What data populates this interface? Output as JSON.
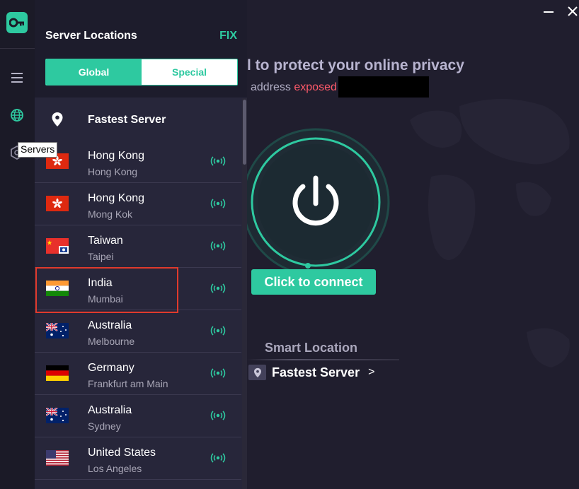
{
  "window": {
    "minimize_icon": "minimize-icon",
    "close_icon": "close-icon"
  },
  "rail": {
    "logo_icon": "key-icon",
    "items": [
      {
        "name": "menu",
        "icon": "hamburger-icon"
      },
      {
        "name": "servers",
        "icon": "globe-icon"
      },
      {
        "name": "settings",
        "icon": "hexagon-icon"
      }
    ],
    "tooltip": "Servers"
  },
  "panel": {
    "title": "Server Locations",
    "fix_label": "FIX",
    "tabs": {
      "global": "Global",
      "special": "Special"
    },
    "fastest_label": "Fastest Server",
    "servers": [
      {
        "country": "Hong Kong",
        "city": "Hong Kong",
        "flag": "hk"
      },
      {
        "country": "Hong Kong",
        "city": "Mong Kok",
        "flag": "hk"
      },
      {
        "country": "Taiwan",
        "city": "Taipei",
        "flag": "tw"
      },
      {
        "country": "India",
        "city": "Mumbai",
        "flag": "in"
      },
      {
        "country": "Australia",
        "city": "Melbourne",
        "flag": "au"
      },
      {
        "country": "Germany",
        "city": "Frankfurt am Main",
        "flag": "de"
      },
      {
        "country": "Australia",
        "city": "Sydney",
        "flag": "au"
      },
      {
        "country": "United States",
        "city": "Los Angeles",
        "flag": "us"
      }
    ]
  },
  "main": {
    "headline": "l to protect your online privacy",
    "ip_prefix": "address",
    "ip_status": "exposed",
    "connect_label": "Click to connect",
    "smart_location_label": "Smart Location",
    "smart_server_name": "Fastest Server",
    "smart_server_chevron": ">"
  },
  "colors": {
    "accent": "#2ec9a0",
    "exposed": "#ff5a6a",
    "background": "#201e2e",
    "panel": "#27263a",
    "highlight": "#e03a2c"
  }
}
